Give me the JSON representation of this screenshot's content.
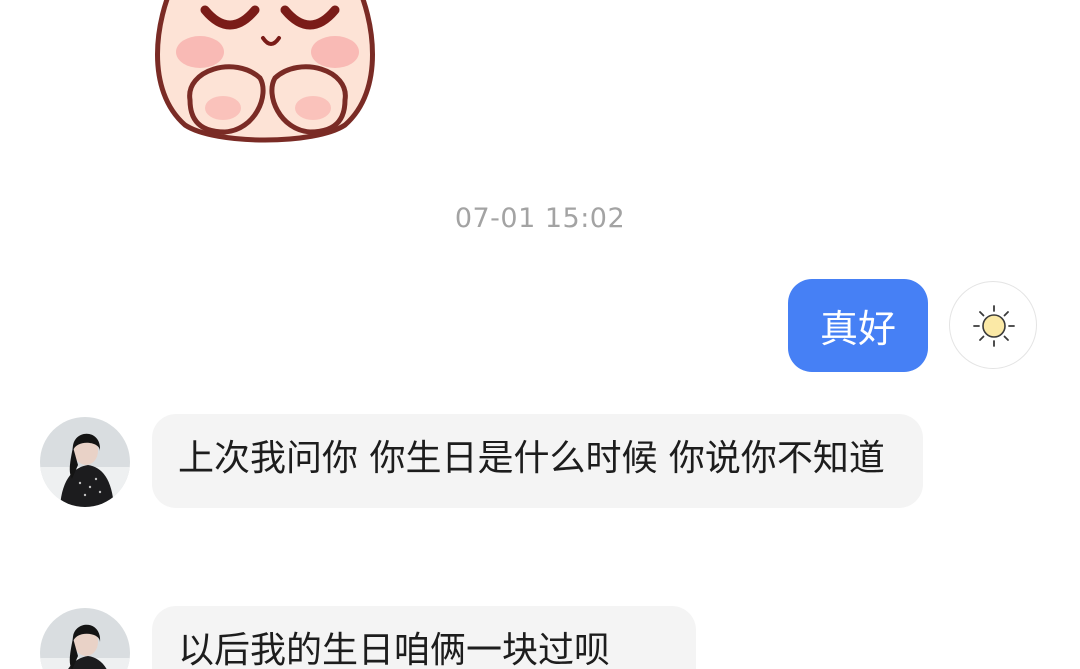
{
  "chat": {
    "timestamp": "07-01 15:02",
    "messages": [
      {
        "sender": "self",
        "text": "真好"
      },
      {
        "sender": "other",
        "text": "上次我问你 你生日是什么时候 你说你不知道"
      },
      {
        "sender": "other",
        "text": "以后我的生日咱俩一块过呗"
      }
    ]
  },
  "colors": {
    "outgoing_bubble": "#4680f5",
    "incoming_bubble": "#f4f4f4",
    "timestamp_text": "#a3a3a3",
    "background": "#ffffff"
  },
  "icons": {
    "sticker": "blushing-peach-sticker",
    "self_avatar": "sun-icon",
    "other_avatar": "girl-avatar"
  }
}
